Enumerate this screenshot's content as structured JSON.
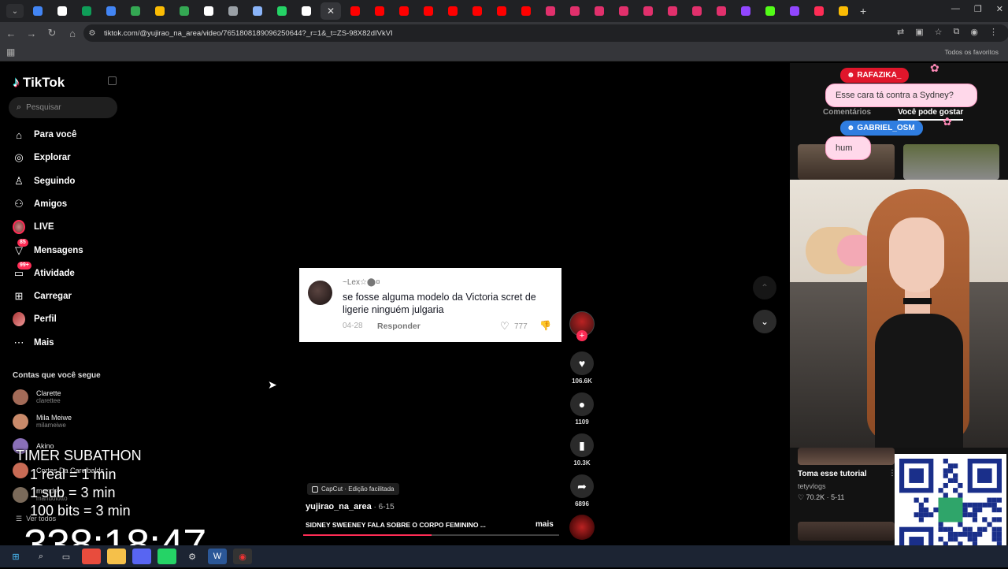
{
  "browser": {
    "url": "tiktok.com/@yujirao_na_area/video/7651808189096250644?_r=1&_t=ZS-98X82dIVkVI",
    "all_favorites": "Todos os favoritos",
    "tab_favicon_colors": [
      "#4285f4",
      "#ffffff",
      "#0f9d58",
      "#4285f4",
      "#34a853",
      "#fbbc04",
      "#34a853",
      "#ffffff",
      "#9aa0a6",
      "#8ab4f8",
      "#25d366",
      "#ffffff",
      "#ff0000",
      "#ff0000",
      "#ff0000",
      "#ff0000",
      "#ff0000",
      "#ff0000",
      "#ff0000",
      "#ff0000",
      "#e1306c",
      "#e1306c",
      "#e1306c",
      "#e1306c",
      "#e1306c",
      "#e1306c",
      "#e1306c",
      "#e1306c",
      "#9146ff",
      "#53fc18",
      "#9146ff",
      "#fe2c55",
      "#fbbc04"
    ]
  },
  "sidebar": {
    "logo": "TikTok",
    "search_placeholder": "Pesquisar",
    "nav": [
      {
        "label": "Para você",
        "icon": "home-icon"
      },
      {
        "label": "Explorar",
        "icon": "compass-icon"
      },
      {
        "label": "Seguindo",
        "icon": "following-icon"
      },
      {
        "label": "Amigos",
        "icon": "friends-icon"
      },
      {
        "label": "LIVE",
        "icon": "live-icon"
      },
      {
        "label": "Mensagens",
        "icon": "messages-icon",
        "badge": "85"
      },
      {
        "label": "Atividade",
        "icon": "activity-icon",
        "badge": "99+"
      },
      {
        "label": "Carregar",
        "icon": "upload-icon"
      },
      {
        "label": "Perfil",
        "icon": "profile-avatar"
      },
      {
        "label": "Mais",
        "icon": "more-icon"
      }
    ],
    "following_title": "Contas que você segue",
    "accounts": [
      {
        "name": "Clarette",
        "handle": "clarettee"
      },
      {
        "name": "Mila Meiwe",
        "handle": "milameiwe"
      },
      {
        "name": "Akino",
        "handle": ""
      },
      {
        "name": "Cortes Da Carolbalds",
        "handle": ""
      },
      {
        "name": "mande",
        "handle": "mandolotto"
      }
    ],
    "see_all": "Ver todos"
  },
  "overlay": {
    "title": "TIMER SUBATHON",
    "line1": "1 real = 1 min",
    "line2": "1 sub = 3 min",
    "line3": "100 bits = 3 min",
    "timer": "338:18:47"
  },
  "comment": {
    "user": "~Lex☆⬤¤",
    "text": "se fosse alguma modelo da Victoria scret de ligerie ninguém julgaria",
    "date": "04-28",
    "reply": "Responder",
    "likes": "777"
  },
  "video": {
    "capcut": "CapCut · Edição facilitada",
    "author": "yujirao_na_area",
    "date": " · 6-15",
    "description": "SIDNEY SWEENEY FALA SOBRE O CORPO FEMININO ...",
    "more": "mais",
    "progress": 0.5,
    "likes": "106.6K",
    "comments": "1109",
    "saves": "10.3K",
    "shares": "6896"
  },
  "right_panel": {
    "tab_comments": "Comentários",
    "tab_suggestions": "Você pode gostar",
    "rec_title": "Toma esse tutorial",
    "rec_user": "tetyvlogs",
    "rec_meta": "♡ 70.2K · 5-11"
  },
  "chat": {
    "user1": "RAFAZIKA_",
    "msg1": "Esse cara tá contra a Sydney?",
    "user2": "GABRIEL_OSM",
    "msg2": "hum"
  }
}
